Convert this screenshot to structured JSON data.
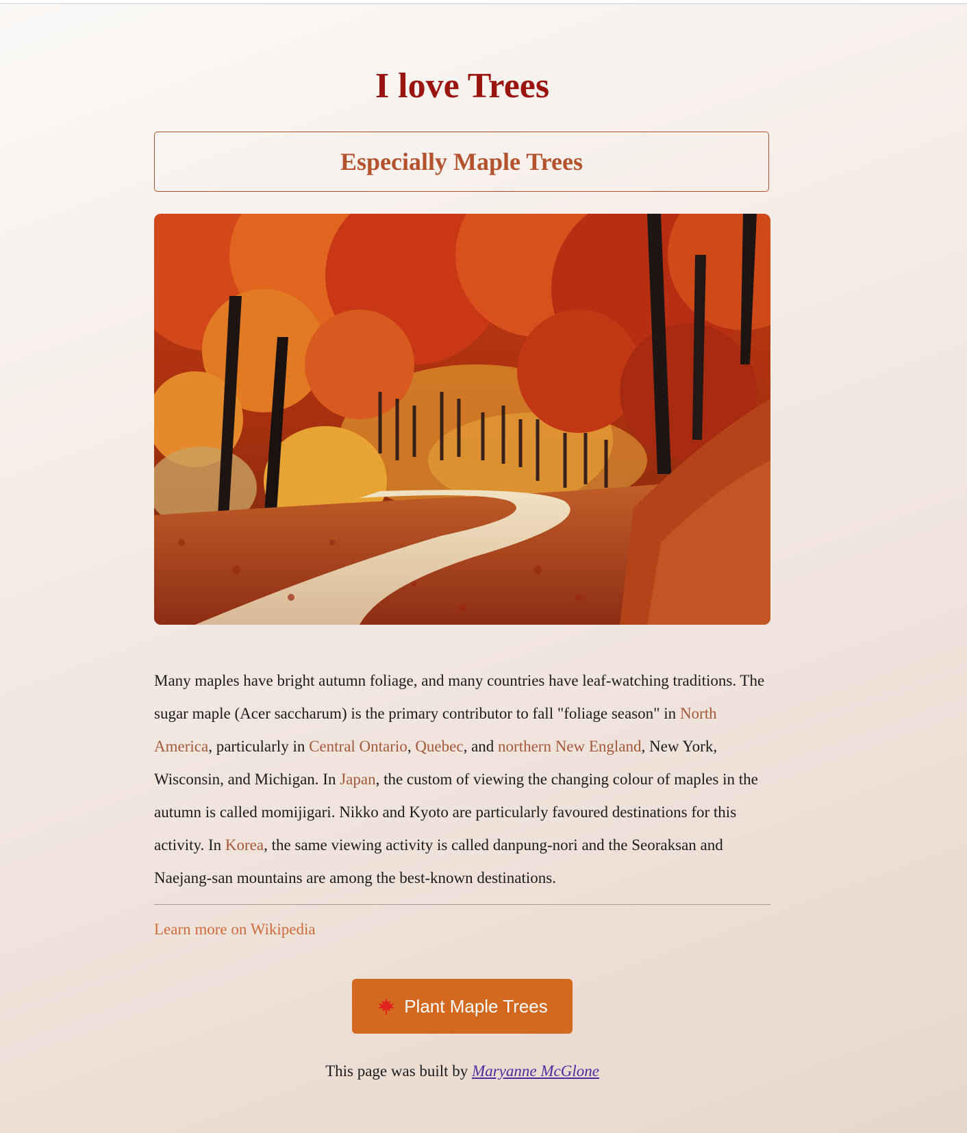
{
  "page": {
    "title": "I love Trees",
    "subtitle": "Especially Maple Trees"
  },
  "photo": {
    "icon": "autumn-forest-path-photo"
  },
  "paragraph": {
    "t1": "Many maples have bright autumn foliage, and many countries have leaf-watching traditions. The sugar maple (Acer saccharum) is the primary contributor to fall \"foliage season\" in ",
    "link_north_america": "North America",
    "t2": ", particularly in ",
    "link_central_ontario": "Central Ontario",
    "t3": ", ",
    "link_quebec": "Quebec",
    "t4": ", and ",
    "link_new_england": "northern New England",
    "t5": ", New York, Wisconsin, and Michigan. In ",
    "link_japan": "Japan",
    "t6": ", the custom of viewing the changing colour of maples in the autumn is called momijigari. Nikko and Kyoto are particularly favoured destinations for this activity. In ",
    "link_korea": "Korea",
    "t7": ", the same viewing activity is called danpung-nori and the Seoraksan and Naejang-san mountains are among the best-known destinations."
  },
  "wiki_link": "Learn more on Wikipedia",
  "button": {
    "label": "Plant Maple Trees",
    "icon": "maple-leaf-icon"
  },
  "footer": {
    "prefix": "This page was built by ",
    "author": "Maryanne McGlone"
  },
  "colors": {
    "title": "#9a1410",
    "subtitle": "#b3522c",
    "link": "#a3583a",
    "wiki_link": "#cf6a3c",
    "button_bg": "#d2691e",
    "author_link": "#4b2aa0"
  }
}
